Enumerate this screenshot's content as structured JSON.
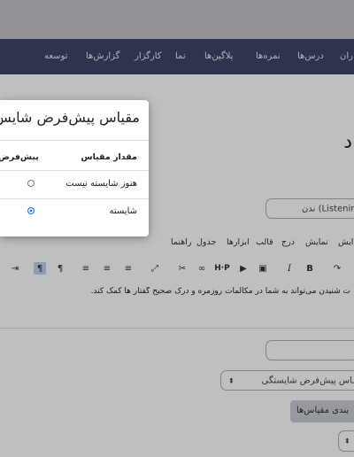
{
  "navbar": {
    "items": [
      "توسعه",
      "گزارش‌ها",
      "کارگزار",
      "نما",
      "پلاگین‌ها",
      "نمره‌ها",
      "درس‌ها",
      "ران"
    ]
  },
  "page": {
    "heading": "د",
    "name_field_value": "ندن (Listening)",
    "menubar": [
      "راهنما",
      "جدول",
      "ابزارها",
      "قالب",
      "درج",
      "نمایش",
      "ایش"
    ],
    "editor_text": "ت شنیدن می‌تواند به شما در مکالمات روزمره و درک صحیح گفتار ها کمک کند.",
    "default_scale_select": "ـاس پیش‌فرض شایستگی",
    "scale_config_button": "بندی مقیاس‌ها"
  },
  "modal": {
    "title": "مقیاس پیش‌فرض شایس",
    "col_value": "مقدار مقیاس",
    "col_default": "پیش‌فرض",
    "rows": [
      {
        "label": "هنوز شایسته نیست",
        "checked": false
      },
      {
        "label": "شایسته",
        "checked": true
      }
    ]
  },
  "colors": {
    "navbar_bg": "#3e4668",
    "radio_checked": "#1a73e8",
    "toolbar_active": "#bcd2ef"
  },
  "icons": [
    "bold-icon",
    "italic-icon",
    "image-icon",
    "media-icon",
    "h5p-icon",
    "link-icon",
    "unlink-icon",
    "fullscreen-icon",
    "align-left-icon",
    "align-center-icon",
    "align-right-icon",
    "ltr-icon",
    "rtl-icon",
    "indent-icon",
    "redo-icon"
  ]
}
